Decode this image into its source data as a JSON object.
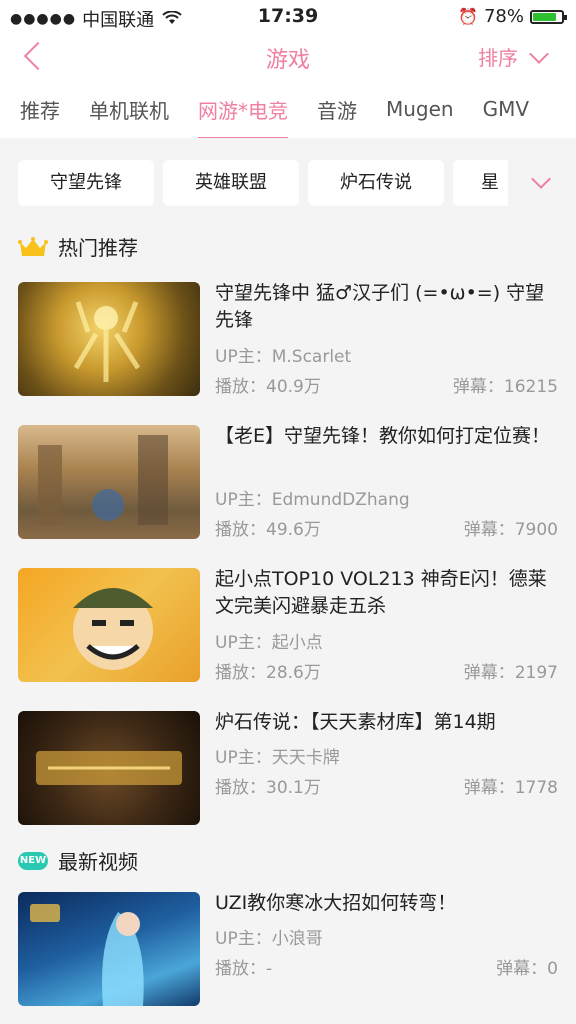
{
  "status_bar": {
    "signal": "●●●●●",
    "carrier": "中国联通",
    "time": "17:39",
    "battery_percent": "78%",
    "battery_level": 0.78
  },
  "nav": {
    "title": "游戏",
    "sort_label": "排序"
  },
  "tabs": [
    {
      "label": "推荐",
      "active": false
    },
    {
      "label": "单机联机",
      "active": false
    },
    {
      "label": "网游*电竞",
      "active": true
    },
    {
      "label": "音游",
      "active": false
    },
    {
      "label": "Mugen",
      "active": false
    },
    {
      "label": "GMV",
      "active": false
    }
  ],
  "chips": [
    "守望先锋",
    "英雄联盟",
    "炉石传说",
    "星"
  ],
  "sections": {
    "hot": {
      "title": "热门推荐"
    },
    "new": {
      "title": "最新视频",
      "badge": "NEW"
    }
  },
  "videos": [
    {
      "title": "守望先锋中 猛♂汉子们 (=•ω•=) 守望先锋",
      "up_label": "UP主：",
      "up": "M.Scarlet",
      "play_label": "播放：",
      "play": "40.9万",
      "dm_label": "弹幕：",
      "dm": "16215"
    },
    {
      "title": "【老E】守望先锋！教你如何打定位赛！",
      "up_label": "UP主：",
      "up": "EdmundDZhang",
      "play_label": "播放：",
      "play": "49.6万",
      "dm_label": "弹幕：",
      "dm": "7900"
    },
    {
      "title": "起小点TOP10 VOL213 神奇E闪！德莱文完美闪避暴走五杀",
      "up_label": "UP主：",
      "up": "起小点",
      "play_label": "播放：",
      "play": "28.6万",
      "dm_label": "弹幕：",
      "dm": "2197"
    },
    {
      "title": "炉石传说：【天天素材库】第14期",
      "up_label": "UP主：",
      "up": "天天卡牌",
      "play_label": "播放：",
      "play": "30.1万",
      "dm_label": "弹幕：",
      "dm": "1778"
    },
    {
      "title": "UZI教你寒冰大招如何转弯！",
      "up_label": "UP主：",
      "up": "小浪哥",
      "play_label": "播放：",
      "play": "-",
      "dm_label": "弹幕：",
      "dm": "0"
    }
  ]
}
